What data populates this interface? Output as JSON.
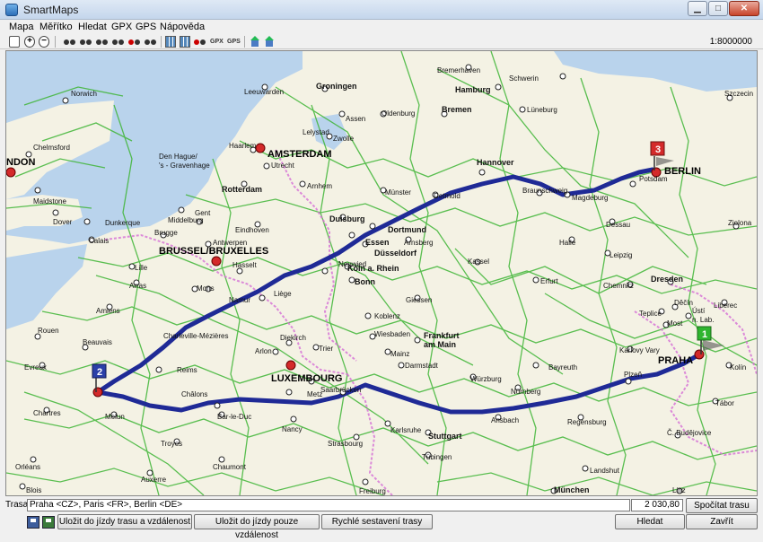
{
  "window": {
    "title": "SmartMaps",
    "minimize_glyph": "▁",
    "maximize_glyph": "□",
    "close_glyph": "✕"
  },
  "menu": [
    {
      "label": "Mapa"
    },
    {
      "label": "Měřítko"
    },
    {
      "label": "Hledat"
    },
    {
      "label": "GPX"
    },
    {
      "label": "GPS"
    },
    {
      "label": "Nápověda"
    }
  ],
  "toolbar": {
    "zoom_in_glyph": "+",
    "zoom_out_glyph": "−",
    "gpx_label": "GPX",
    "gps_label": "GPS",
    "scale": "1:8000000"
  },
  "map": {
    "cities_major": [
      {
        "name": "AMSTERDAM"
      },
      {
        "name": "BRUSSEL/BRUXELLES"
      },
      {
        "name": "LUXEMBOURG"
      },
      {
        "name": "BERLIN"
      },
      {
        "name": "PRAHA"
      },
      {
        "name": "NDON"
      }
    ],
    "cities": [
      "Norwich",
      "Chelmsford",
      "Maidstone",
      "Dover",
      "Leeuwarden",
      "Groningen",
      "Assen",
      "Zwolle",
      "Lelystad",
      "Haarlem",
      "Den Hague/",
      "'s - Gravenhage",
      "Utrecht",
      "Rotterdam",
      "Arnhem",
      "Middelburg",
      "Gent",
      "Brugge",
      "Antwerpen",
      "Eindhoven",
      "Dunkerque",
      "Calais",
      "Lille",
      "Arras",
      "Amiens",
      "Rouen",
      "Beauvais",
      "Evreux",
      "Chartres",
      "Melun",
      "Reims",
      "Charleville-Mézières",
      "Namur",
      "Mons",
      "Liège",
      "Hasselt",
      "Arlon",
      "Diekirch",
      "Trier",
      "Metz",
      "Nancy",
      "Châlons",
      "Bar-le-Duc",
      "Troyes",
      "Chaumont",
      "Auxerre",
      "Orléans",
      "Blois",
      "Strasbourg",
      "Saarbrücken",
      "Karlsruhe",
      "Stuttgart",
      "Tübingen",
      "Freiburg",
      "Duisburg",
      "Essen",
      "Düsseldorf",
      "Köln a. Rhein",
      "Bonn",
      "Dortmund",
      "Arnsberg",
      "Münster",
      "Detmold",
      "Bremen",
      "Bremerhaven",
      "Hamburg",
      "Schwerin",
      "Lüneburg",
      "Oldenburg",
      "Hannover",
      "Braunschweig",
      "Magdeburg",
      "Dessau",
      "Halle",
      "Leipzig",
      "Kassel",
      "Erfurt",
      "Giessen",
      "Koblenz",
      "Wiesbaden",
      "Frankfurt",
      "am Main",
      "Mainz",
      "Darmstadt",
      "Würzburg",
      "Nürnberg",
      "Ansbach",
      "Regensburg",
      "Bayreuth",
      "Chemnitz",
      "Dresden",
      "Plzeň",
      "Karlovy Vary",
      "Most",
      "Teplice",
      "Děčín",
      "Ústí",
      "n. Lab.",
      "Liberec",
      "Zielona",
      "Szczecin",
      "Kolín",
      "Tábor",
      "Č. Budějovice",
      "Landshut",
      "München",
      "Linz",
      "Neuwied",
      "Potsdam"
    ],
    "waypoints": [
      {
        "number": "1",
        "color": "#2fb52f"
      },
      {
        "number": "2",
        "color": "#2a3fa8"
      },
      {
        "number": "3",
        "color": "#d42a2a"
      }
    ],
    "colors": {
      "land": "#f4f2e4",
      "sea": "#b9d3ec",
      "road": "#3fb536",
      "route": "#1f2a96",
      "border": "#d66fd6"
    }
  },
  "bottom": {
    "trasa_label": "Trasa",
    "route_value": "Praha <CZ>, Paris <FR>, Berlin <DE>",
    "distance_value": "2 030,80",
    "compute_button": "Spočítat trasu",
    "save_route_distance_button": "Uložit do jízdy trasu a vzdálenost",
    "save_distance_button": "Uložit do jízdy pouze vzdálenost",
    "quick_route_button": "Rychlé sestavení trasy",
    "search_button": "Hledat",
    "close_button": "Zavřít"
  }
}
